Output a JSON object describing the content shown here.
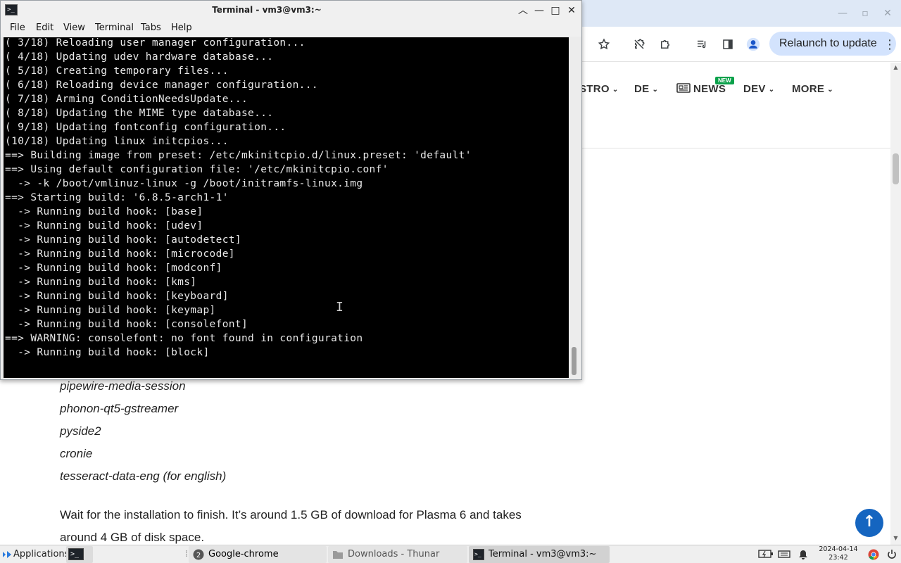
{
  "chrome": {
    "relaunch_label": "Relaunch to update",
    "nav": [
      {
        "label": "STRO",
        "name": "nav-distro"
      },
      {
        "label": "DE",
        "name": "nav-de"
      },
      {
        "label": "NEWS",
        "name": "nav-news"
      },
      {
        "label": "DEV",
        "name": "nav-dev"
      },
      {
        "label": "MORE",
        "name": "nav-more"
      }
    ],
    "new_badge": "NEW",
    "chevron": "⌄",
    "packages": [
      "pipewire-media-session",
      "phonon-qt5-gstreamer",
      "pyside2",
      "cronie",
      "tesseract-data-eng (for english)"
    ],
    "paragraph": "Wait for the installation to finish. It’s around 1.5 GB of download for Plasma 6 and takes around 4 GB of disk space.",
    "scroll_top_glyph": "↑",
    "accent_color": "#1565c0"
  },
  "terminal": {
    "title": "Terminal - vm3@vm3:~",
    "menu": [
      "File",
      "Edit",
      "View",
      "Terminal",
      "Tabs",
      "Help"
    ],
    "lines": [
      "( 3/18) Reloading user manager configuration...",
      "( 4/18) Updating udev hardware database...",
      "( 5/18) Creating temporary files...",
      "( 6/18) Reloading device manager configuration...",
      "( 7/18) Arming ConditionNeedsUpdate...",
      "( 8/18) Updating the MIME type database...",
      "( 9/18) Updating fontconfig configuration...",
      "(10/18) Updating linux initcpios...",
      "==> Building image from preset: /etc/mkinitcpio.d/linux.preset: 'default'",
      "==> Using default configuration file: '/etc/mkinitcpio.conf'",
      "  -> -k /boot/vmlinuz-linux -g /boot/initramfs-linux.img",
      "==> Starting build: '6.8.5-arch1-1'",
      "  -> Running build hook: [base]",
      "  -> Running build hook: [udev]",
      "  -> Running build hook: [autodetect]",
      "  -> Running build hook: [microcode]",
      "  -> Running build hook: [modconf]",
      "  -> Running build hook: [kms]",
      "  -> Running build hook: [keyboard]",
      "  -> Running build hook: [keymap]",
      "  -> Running build hook: [consolefont]",
      "==> WARNING: consolefont: no font found in configuration",
      "  -> Running build hook: [block]"
    ]
  },
  "taskbar": {
    "applications_label": "Applications",
    "tasks": [
      {
        "label": "Google-chrome",
        "badge": "2",
        "name": "task-google-chrome"
      },
      {
        "label": "Downloads - Thunar",
        "name": "task-thunar"
      },
      {
        "label": "Terminal - vm3@vm3:~",
        "name": "task-terminal"
      }
    ],
    "date": "2024-04-14",
    "time": "23:42"
  }
}
